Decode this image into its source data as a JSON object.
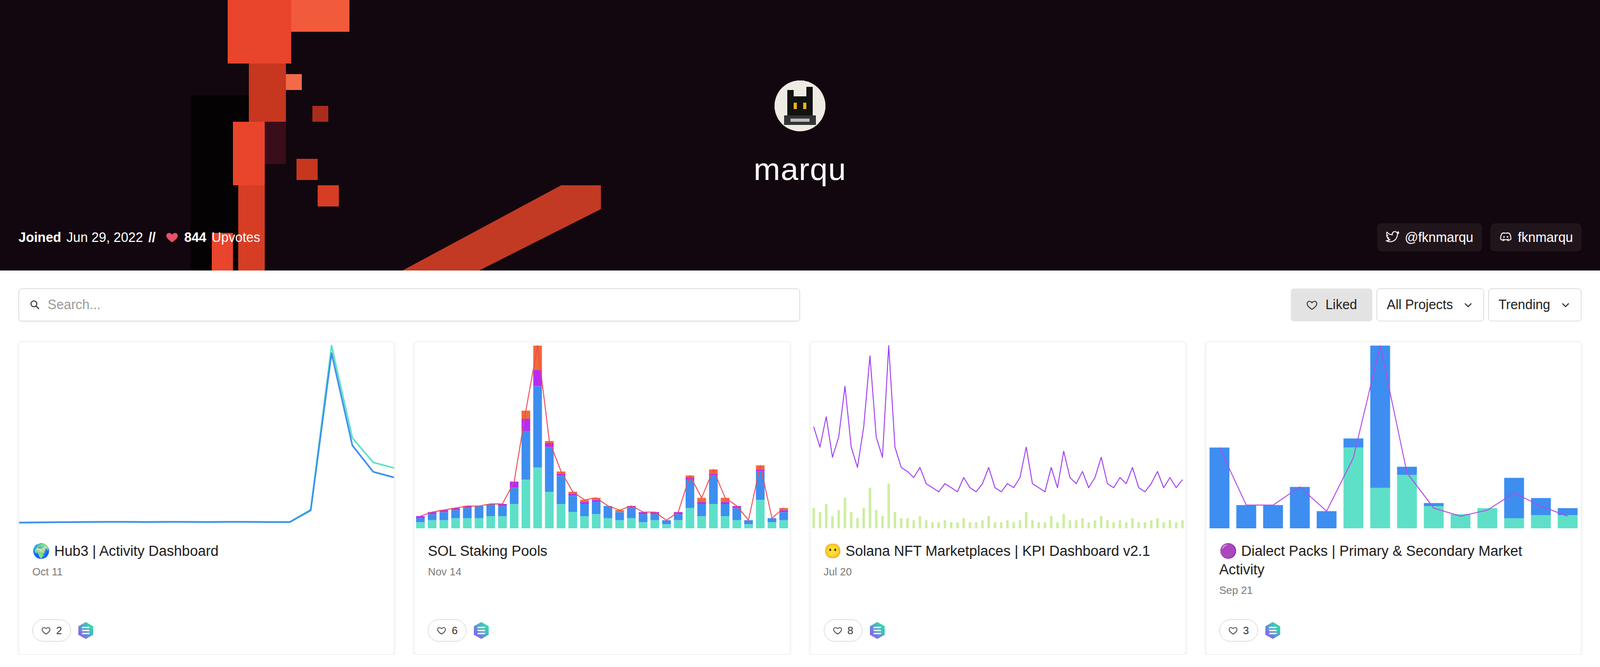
{
  "header": {
    "name": "marqu",
    "joined_label": "Joined",
    "joined_date": "Jun 29, 2022",
    "separator": "//",
    "upvotes": "844",
    "upvotes_label": "Upvotes",
    "socials": [
      {
        "label": "@fknmarqu",
        "kind": "twitter"
      },
      {
        "label": "fknmarqu",
        "kind": "discord"
      }
    ]
  },
  "toolbar": {
    "search": {
      "placeholder": "Search..."
    },
    "liked": {
      "label": "Liked",
      "selected": true
    },
    "filters": [
      {
        "label": "All Projects"
      },
      {
        "label": "Trending"
      }
    ]
  },
  "cards": [
    {
      "title": "🌍 Hub3 | Activity Dashboard",
      "date": "Oct 11",
      "likes": "2",
      "chart": {
        "series": [
          {
            "kind": "line",
            "color": "#5ee0c8",
            "values": [
              3,
              3.2,
              3.3,
              3.4,
              3.5,
              3.5,
              3.4,
              3.5,
              3.5,
              3.4,
              3.5,
              3.5,
              3.4,
              3.4,
              10,
              97,
              48,
              35,
              32
            ]
          },
          {
            "kind": "line",
            "color": "#3d8ef0",
            "values": [
              3,
              3.1,
              3.2,
              3.3,
              3.4,
              3.4,
              3.3,
              3.4,
              3.4,
              3.3,
              3.4,
              3.4,
              3.3,
              3.3,
              9.5,
              93,
              44,
              30,
              27
            ]
          }
        ]
      }
    },
    {
      "title": "SOL Staking Pools",
      "date": "Nov 14",
      "likes": "6",
      "chart": {
        "series": [
          {
            "kind": "bar",
            "color": "#5ee0c8",
            "values": [
              3,
              4,
              4,
              5,
              5,
              5,
              6,
              6,
              12,
              24,
              30,
              18,
              12,
              8,
              6,
              7,
              5,
              4,
              5,
              3,
              4,
              2,
              4,
              10,
              6,
              12,
              6,
              4,
              2,
              14,
              3,
              4
            ]
          },
          {
            "kind": "bar",
            "color": "#3d8ef0",
            "values": [
              2,
              3,
              4,
              4,
              5,
              6,
              6,
              5,
              8,
              24,
              40,
              22,
              14,
              8,
              6,
              6,
              6,
              4,
              5,
              4,
              3,
              2,
              3,
              14,
              6,
              14,
              6,
              6,
              2,
              14,
              2,
              4
            ]
          },
          {
            "kind": "bar",
            "color": "#b72cf5",
            "values": [
              1,
              1,
              1,
              1,
              1,
              0,
              0,
              1,
              3,
              6,
              8,
              2,
              1,
              1,
              1,
              1,
              0,
              0,
              1,
              1,
              1,
              0,
              1,
              1,
              1,
              1,
              1,
              1,
              0,
              1,
              0,
              1
            ]
          },
          {
            "kind": "bar",
            "color": "#f06a3a",
            "values": [
              0,
              0,
              0,
              0,
              0,
              0,
              0,
              0,
              0,
              4,
              12,
              1,
              1,
              1,
              1,
              1,
              0,
              1,
              0,
              0,
              0,
              0,
              0,
              1,
              2,
              2,
              2,
              0,
              0,
              2,
              0,
              1
            ]
          },
          {
            "kind": "line",
            "color": "#ef4b55",
            "values": [
              6,
              8,
              9,
              10,
              11,
              11,
              12,
              12,
              23,
              58,
              90,
              43,
              28,
              18,
              14,
              15,
              11,
              9,
              11,
              8,
              8,
              4,
              8,
              26,
              15,
              29,
              15,
              11,
              4,
              31,
              5,
              10
            ]
          }
        ]
      }
    },
    {
      "title": "😶 Solana NFT Marketplaces | KPI Dashboard v2.1",
      "date": "Jul 20",
      "likes": "8",
      "chart": {
        "series": [
          {
            "kind": "thin-bar",
            "color": "#cdeea0",
            "values": [
              10,
              8,
              12,
              6,
              9,
              15,
              8,
              5,
              10,
              20,
              9,
              6,
              22,
              8,
              5,
              5,
              4,
              6,
              4,
              3,
              3,
              4,
              3,
              3,
              5,
              3,
              3,
              4,
              6,
              3,
              3,
              4,
              3,
              4,
              8,
              4,
              3,
              3,
              6,
              3,
              7,
              4,
              4,
              5,
              3,
              4,
              6,
              4,
              3,
              4,
              3,
              5,
              3,
              3,
              4,
              5,
              3,
              4,
              3,
              4
            ]
          },
          {
            "kind": "line",
            "color": "#a13ef2",
            "values": [
              50,
              40,
              55,
              35,
              45,
              70,
              40,
              30,
              50,
              85,
              45,
              35,
              90,
              40,
              30,
              28,
              25,
              30,
              22,
              20,
              18,
              22,
              20,
              18,
              25,
              20,
              18,
              22,
              30,
              20,
              18,
              22,
              20,
              25,
              40,
              22,
              20,
              18,
              30,
              20,
              38,
              25,
              22,
              28,
              20,
              25,
              35,
              22,
              20,
              25,
              22,
              30,
              20,
              18,
              22,
              28,
              20,
              25,
              20,
              24
            ]
          }
        ]
      }
    },
    {
      "title": "🟣 Dialect Packs | Primary & Secondary Market Activity",
      "date": "Sep 21",
      "likes": "3",
      "chart": {
        "series": [
          {
            "kind": "bar",
            "color": "#5ee0c8",
            "values": [
              0,
              0,
              0,
              0,
              0,
              80,
              40,
              53,
              22,
              14,
              20,
              10,
              13,
              13
            ]
          },
          {
            "kind": "bar",
            "color": "#3d8ef0",
            "values": [
              80,
              23,
              23,
              41,
              17,
              9,
              141,
              8,
              3,
              0,
              0,
              40,
              17,
              7
            ]
          },
          {
            "kind": "line",
            "color": "#b44be6",
            "values": [
              80,
              23,
              23,
              41,
              17,
              70,
              181,
              55,
              20,
              12,
              18,
              35,
              22,
              12
            ]
          }
        ]
      }
    }
  ]
}
